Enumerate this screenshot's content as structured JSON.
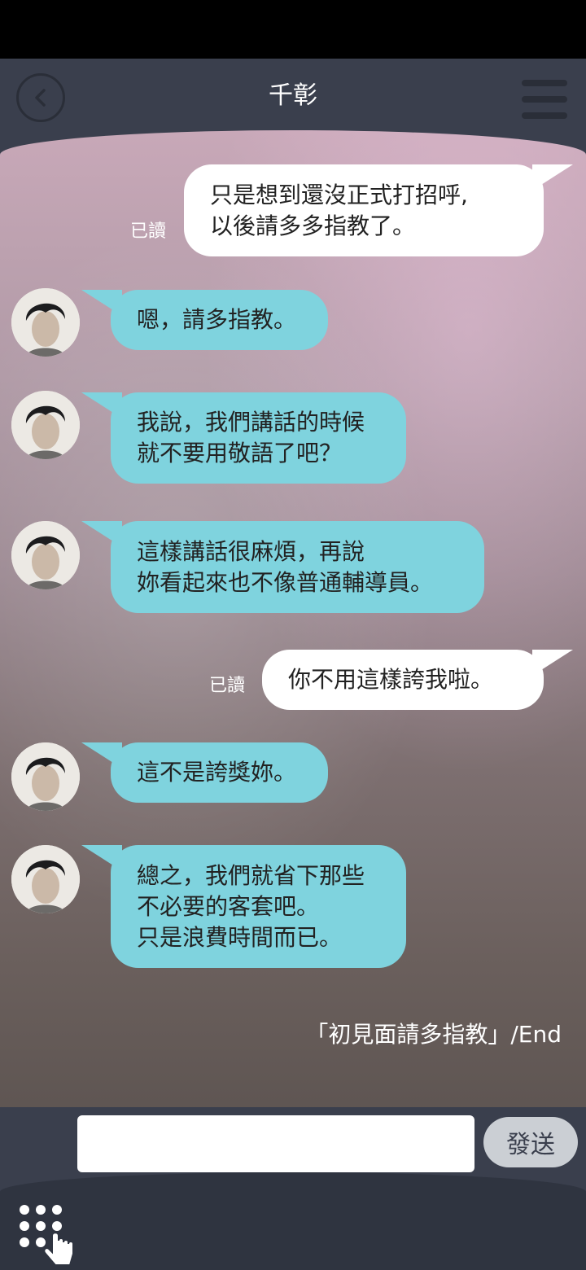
{
  "header": {
    "title": "千彰",
    "back_icon": "back-arrow-icon",
    "menu_icon": "hamburger-menu-icon"
  },
  "messages": [
    {
      "side": "right",
      "text": "只是想到還沒正式打招呼,\n以後請多多指教了。",
      "read": "已讀"
    },
    {
      "side": "left",
      "text": "嗯，請多指教。"
    },
    {
      "side": "left",
      "text": "我說，我們講話的時候\n就不要用敬語了吧？"
    },
    {
      "side": "left",
      "text": "這樣講話很麻煩，再說\n妳看起來也不像普通輔導員。"
    },
    {
      "side": "right",
      "text": "你不用這樣誇我啦。",
      "read": "已讀"
    },
    {
      "side": "left",
      "text": "這不是誇獎妳。"
    },
    {
      "side": "left",
      "text": "總之，我們就省下那些\n不必要的客套吧。\n只是浪費時間而已。"
    }
  ],
  "end_label": "「初見面請多指教」/End",
  "input": {
    "value": "",
    "placeholder": "",
    "send_label": "發送"
  },
  "colors": {
    "header_bg": "#3a3f4d",
    "left_bubble": "#7fd3de",
    "right_bubble": "#ffffff"
  },
  "icons": {
    "keypad": "keypad-hand-icon"
  }
}
